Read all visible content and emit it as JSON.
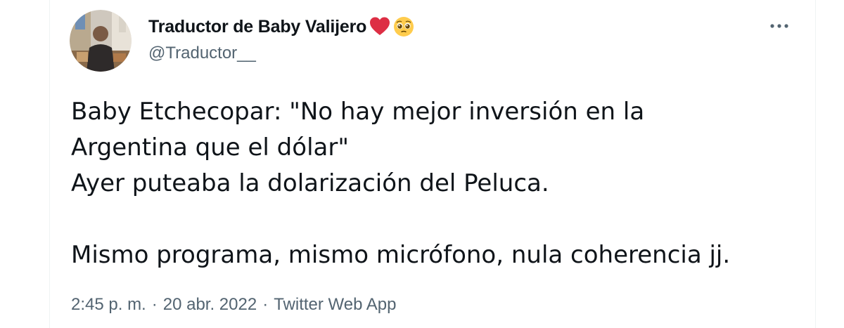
{
  "author": {
    "display_name": "Traductor de Baby Valijero",
    "handle": "@Traductor__",
    "name_emojis": [
      "red-heart",
      "pleading-face"
    ]
  },
  "tweet": {
    "text": "Baby Etchecopar: \"No hay mejor inversión en la\nArgentina que el dólar\"\nAyer puteaba la dolarización del Peluca.\n\nMismo programa, mismo micrófono, nula coherencia jj."
  },
  "meta": {
    "time": "2:45 p. m.",
    "separator": "·",
    "date": "20 abr. 2022",
    "source": "Twitter Web App"
  },
  "colors": {
    "text_primary": "#0f1419",
    "text_secondary": "#536471",
    "heart": "#e0245e"
  },
  "icons": {
    "more": "more-options-icon"
  }
}
